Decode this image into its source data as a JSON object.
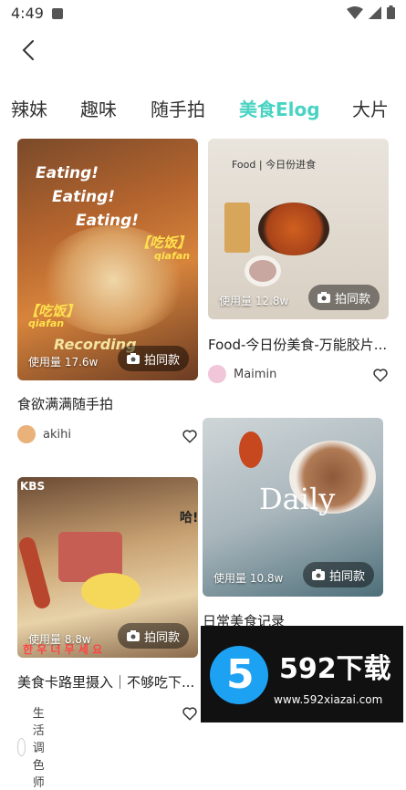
{
  "status": {
    "time": "4:49"
  },
  "tabs": [
    "辣妹",
    "趣味",
    "随手拍",
    "美食Elog",
    "大片"
  ],
  "cards": {
    "c1": {
      "usage": "使用量 17.6w",
      "btn": "拍同款",
      "title": "食欲满满随手拍",
      "author": "akihi",
      "overlay": [
        "Eating!",
        "Eating!",
        "Eating!",
        "【吃饭】",
        "qiafan",
        "【吃饭】",
        "qiafan",
        "Recording"
      ]
    },
    "c2": {
      "usage": "使用量 12.8w",
      "btn": "拍同款",
      "title": "Food-今日份美食-万能胶片...",
      "author": "Maimin",
      "overlay": [
        "Food | 今日份进食"
      ]
    },
    "c3": {
      "usage": "使用量 10.8w",
      "btn": "拍同款",
      "title": "日常美食记录",
      "overlay": [
        "Daily"
      ]
    },
    "c4": {
      "usage": "使用量 8.8w",
      "btn": "拍同款",
      "title": "美食卡路里摄入｜不够吃下...",
      "author": "生活调色师",
      "overlay": [
        "KBS",
        "哈!",
        "한 우 너 무 세 요"
      ]
    }
  },
  "watermark": {
    "brand": "592下载",
    "url": "www.592xiazai.com",
    "digit": "5"
  },
  "colors": {
    "accent": "#48d3c2"
  }
}
